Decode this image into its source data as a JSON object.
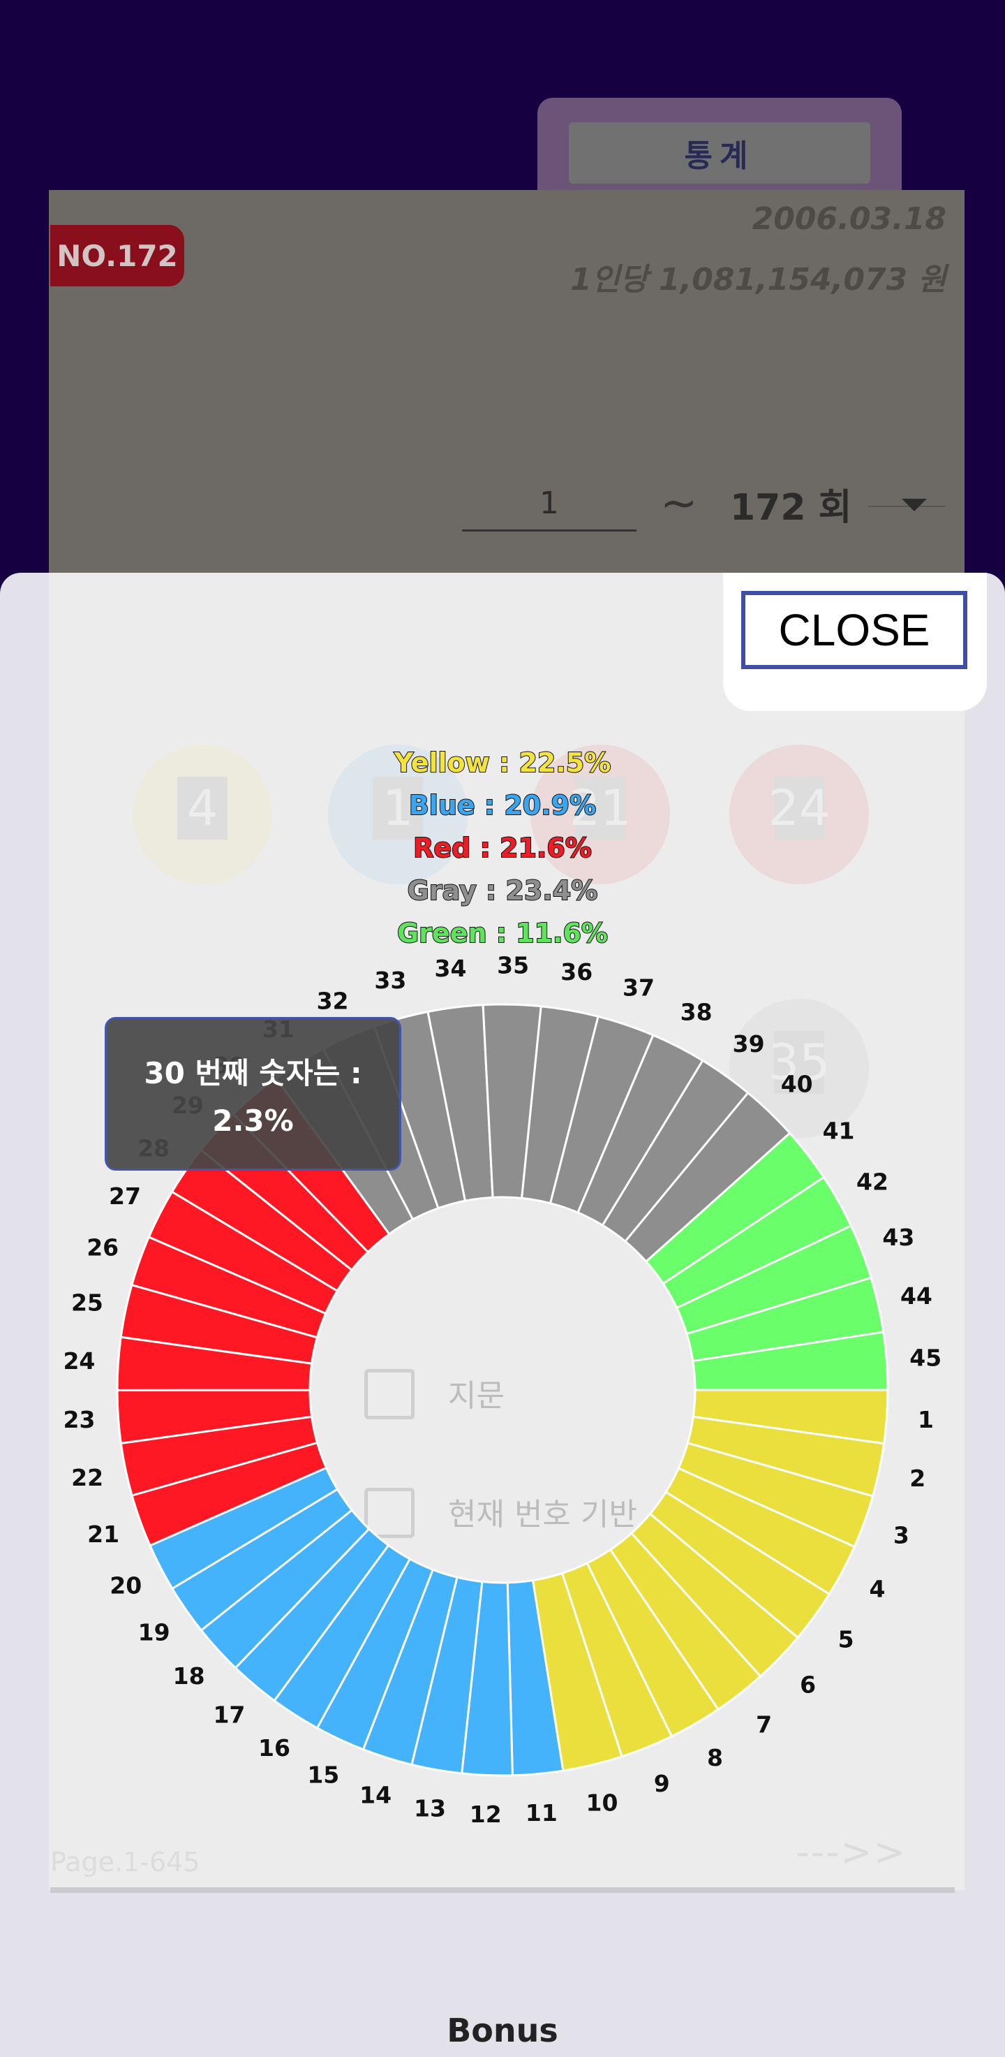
{
  "header": {
    "stats_tab": "통계"
  },
  "draw": {
    "number_badge": "NO.172",
    "date": "2006.03.18",
    "prize": "1인당 1,081,154,073 원"
  },
  "range": {
    "start": "1",
    "separator": "~",
    "end": "172 회"
  },
  "modal": {
    "close_label": "CLOSE"
  },
  "percentages": [
    {
      "label": "Yellow : 22.5%",
      "color": "#f3e33b"
    },
    {
      "label": "Blue : 20.9%",
      "color": "#39a6ef"
    },
    {
      "label": "Red : 21.6%",
      "color": "#ee1c25"
    },
    {
      "label": "Gray : 23.4%",
      "color": "#8f8f8f"
    },
    {
      "label": "Green : 11.6%",
      "color": "#5fe35c"
    }
  ],
  "tooltip": {
    "line1": "30 번째 숫자는 :",
    "line2": "2.3%"
  },
  "background": {
    "balls": [
      "4",
      "1",
      "21",
      "24",
      "35"
    ],
    "options": [
      "지문",
      "현재 번호 기반"
    ],
    "page": "Page.1-645",
    "next": "--->>"
  },
  "footer": {
    "bonus_label": "Bonus"
  },
  "colors": {
    "yellow": "#ebdf3e",
    "blue": "#45b3fb",
    "red": "#fe1823",
    "gray": "#8e8e8e",
    "green": "#6afe6a",
    "sheet": "#e3e2ea",
    "backdrop": "#160042"
  },
  "chart_data": {
    "type": "pie",
    "style": "donut",
    "segments": [
      {
        "label": "1",
        "value": 2.22,
        "color": "yellow"
      },
      {
        "label": "2",
        "value": 2.22,
        "color": "yellow"
      },
      {
        "label": "3",
        "value": 2.22,
        "color": "yellow"
      },
      {
        "label": "4",
        "value": 2.22,
        "color": "yellow"
      },
      {
        "label": "5",
        "value": 2.22,
        "color": "yellow"
      },
      {
        "label": "6",
        "value": 2.22,
        "color": "yellow"
      },
      {
        "label": "7",
        "value": 2.22,
        "color": "yellow"
      },
      {
        "label": "8",
        "value": 2.22,
        "color": "yellow"
      },
      {
        "label": "9",
        "value": 2.22,
        "color": "yellow"
      },
      {
        "label": "10",
        "value": 2.5,
        "color": "yellow"
      },
      {
        "label": "11",
        "value": 2.1,
        "color": "blue"
      },
      {
        "label": "12",
        "value": 2.1,
        "color": "blue"
      },
      {
        "label": "13",
        "value": 2.1,
        "color": "blue"
      },
      {
        "label": "14",
        "value": 2.1,
        "color": "blue"
      },
      {
        "label": "15",
        "value": 2.1,
        "color": "blue"
      },
      {
        "label": "16",
        "value": 2.1,
        "color": "blue"
      },
      {
        "label": "17",
        "value": 2.1,
        "color": "blue"
      },
      {
        "label": "18",
        "value": 2.1,
        "color": "blue"
      },
      {
        "label": "19",
        "value": 2.1,
        "color": "blue"
      },
      {
        "label": "20",
        "value": 2.0,
        "color": "blue"
      },
      {
        "label": "21",
        "value": 2.2,
        "color": "red"
      },
      {
        "label": "22",
        "value": 2.2,
        "color": "red"
      },
      {
        "label": "23",
        "value": 2.2,
        "color": "red"
      },
      {
        "label": "24",
        "value": 2.2,
        "color": "red"
      },
      {
        "label": "25",
        "value": 2.2,
        "color": "red"
      },
      {
        "label": "26",
        "value": 2.1,
        "color": "red"
      },
      {
        "label": "27",
        "value": 2.1,
        "color": "red"
      },
      {
        "label": "28",
        "value": 2.1,
        "color": "red"
      },
      {
        "label": "29",
        "value": 2.0,
        "color": "red"
      },
      {
        "label": "30",
        "value": 2.3,
        "color": "red"
      },
      {
        "label": "31",
        "value": 2.3,
        "color": "gray"
      },
      {
        "label": "32",
        "value": 2.3,
        "color": "gray"
      },
      {
        "label": "33",
        "value": 2.3,
        "color": "gray"
      },
      {
        "label": "34",
        "value": 2.3,
        "color": "gray"
      },
      {
        "label": "35",
        "value": 2.4,
        "color": "gray"
      },
      {
        "label": "36",
        "value": 2.4,
        "color": "gray"
      },
      {
        "label": "37",
        "value": 2.4,
        "color": "gray"
      },
      {
        "label": "38",
        "value": 2.3,
        "color": "gray"
      },
      {
        "label": "39",
        "value": 2.3,
        "color": "gray"
      },
      {
        "label": "40",
        "value": 2.4,
        "color": "gray"
      },
      {
        "label": "41",
        "value": 2.3,
        "color": "green"
      },
      {
        "label": "42",
        "value": 2.3,
        "color": "green"
      },
      {
        "label": "43",
        "value": 2.3,
        "color": "green"
      },
      {
        "label": "44",
        "value": 2.3,
        "color": "green"
      },
      {
        "label": "45",
        "value": 2.4,
        "color": "green"
      }
    ]
  }
}
